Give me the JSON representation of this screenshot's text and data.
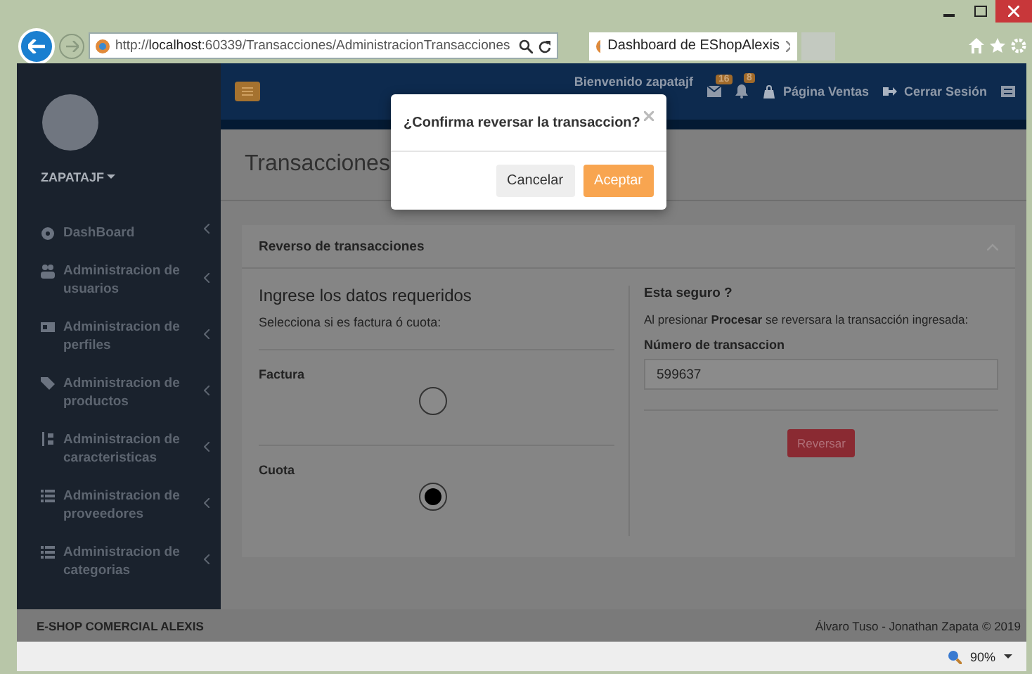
{
  "browser": {
    "address": "http://**localhost**:60339/Transacciones/AdministracionTransacciones",
    "tab_title": "Dashboard de EShopAlexis",
    "zoom": "90%"
  },
  "sidebar": {
    "user": "ZAPATAJF",
    "items": [
      {
        "label": "DashBoard",
        "kind": "dashboard"
      },
      {
        "label": "Administracion de usuarios",
        "kind": "users"
      },
      {
        "label": "Administracion de perfiles",
        "kind": "card"
      },
      {
        "label": "Administracion de productos",
        "kind": "tag"
      },
      {
        "label": "Administracion de caracteristicas",
        "kind": "sort"
      },
      {
        "label": "Administracion de proveedores",
        "kind": "list"
      },
      {
        "label": "Administracion de categorias",
        "kind": "list"
      }
    ]
  },
  "navbar": {
    "greeting": "Bienvenido zapatajf",
    "messages_badge": "16",
    "alerts_badge": "8",
    "links": [
      {
        "label": "Página Ventas",
        "kind": "bag"
      },
      {
        "label": "Cerrar Sesión",
        "kind": "signout"
      }
    ]
  },
  "page_title": "Transacciones",
  "panel": {
    "title": "Reverso de transacciones",
    "left": {
      "heading": "Ingrese los datos requeridos",
      "prompt": "Selecciona si es factura ó cuota:",
      "options": [
        {
          "label": "Factura",
          "selected": false
        },
        {
          "label": "Cuota",
          "selected": true
        }
      ]
    },
    "right": {
      "heading": "Esta seguro ?",
      "note": "Al presionar **Procesar** se reversara la transacción ingresada:",
      "field_label": "Número de transaccion",
      "field_value": "599637",
      "button": "Reversar"
    }
  },
  "footer": {
    "left": "E-SHOP COMERCIAL ALEXIS",
    "right": "Álvaro Tuso - Jonathan Zapata © 2019"
  },
  "modal": {
    "title": "¿Confirma reversar la transaccion?",
    "buttons": [
      {
        "label": "Cancelar",
        "kind": "default"
      },
      {
        "label": "Aceptar",
        "kind": "primary"
      }
    ]
  }
}
